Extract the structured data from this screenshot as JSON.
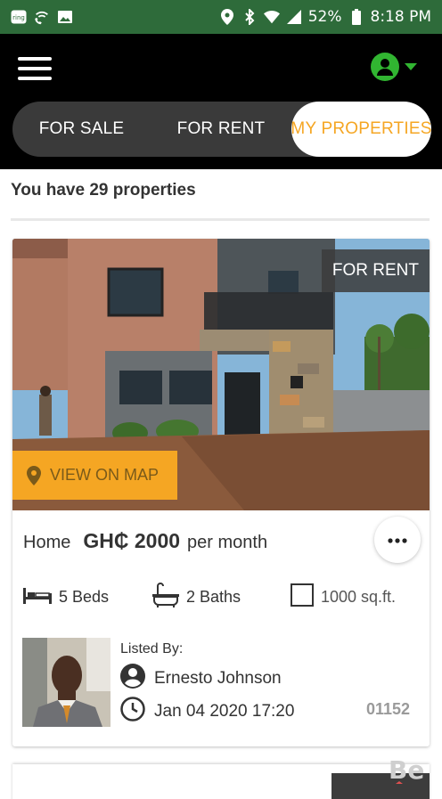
{
  "status_bar": {
    "battery": "52%",
    "time": "8:18 PM",
    "icons": [
      "ring-icon",
      "wifi-call-icon",
      "gallery-icon",
      "location-icon",
      "bluetooth-icon",
      "wifi-icon",
      "signal-icon",
      "battery-icon"
    ]
  },
  "header": {
    "menu_icon": "hamburger-icon",
    "avatar_icon": "user-icon",
    "tabs": [
      {
        "label": "FOR SALE"
      },
      {
        "label": "FOR RENT"
      },
      {
        "label": "MY PROPERTIES"
      }
    ],
    "active_tab_color": "#f5a623"
  },
  "summary": {
    "text": "You have 29 properties"
  },
  "listing": {
    "badge": "FOR RENT",
    "map_button": "VIEW ON MAP",
    "type": "Home",
    "price": "GH₵ 2000",
    "period": "per month",
    "beds": "5 Beds",
    "baths": "2 Baths",
    "area": "1000 sq.ft.",
    "listed_by_label": "Listed By:",
    "agent_name": "Ernesto Johnson",
    "date": "Jan 04 2020 17:20",
    "id": "01152"
  },
  "colors": {
    "status_bar": "#2e6b3a",
    "header": "#000000",
    "accent": "#f5a623",
    "avatar": "#31b531"
  }
}
